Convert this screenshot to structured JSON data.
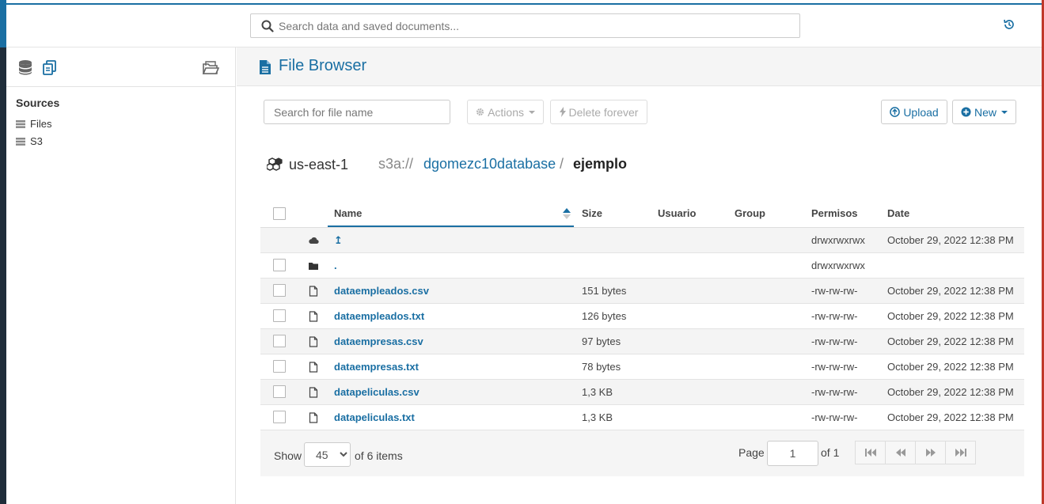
{
  "search": {
    "placeholder": "Search data and saved documents..."
  },
  "sidebar": {
    "sources_title": "Sources",
    "items": [
      {
        "label": "Files"
      },
      {
        "label": "S3"
      }
    ]
  },
  "main": {
    "title": "File Browser",
    "file_search_placeholder": "Search for file name",
    "actions_label": "Actions",
    "delete_label": "Delete forever",
    "upload_label": "Upload",
    "new_label": "New"
  },
  "breadcrumb": {
    "region": "us-east-1",
    "scheme": "s3a://",
    "bucket": "dgomezc10database",
    "separator": "/",
    "folder": "ejemplo"
  },
  "table": {
    "headers": {
      "name": "Name",
      "size": "Size",
      "user": "Usuario",
      "group": "Group",
      "perms": "Permisos",
      "date": "Date"
    },
    "rows": [
      {
        "icon": "cloud-icon",
        "name": "↥",
        "size": "",
        "user": "",
        "group": "",
        "perms": "drwxrwxrwx",
        "date": "October 29, 2022 12:38 PM",
        "checkbox": false
      },
      {
        "icon": "folder-icon",
        "name": ".",
        "size": "",
        "user": "",
        "group": "",
        "perms": "drwxrwxrwx",
        "date": "",
        "checkbox": true
      },
      {
        "icon": "file-icon",
        "name": "dataempleados.csv",
        "size": "151 bytes",
        "user": "",
        "group": "",
        "perms": "-rw-rw-rw-",
        "date": "October 29, 2022 12:38 PM",
        "checkbox": true
      },
      {
        "icon": "file-icon",
        "name": "dataempleados.txt",
        "size": "126 bytes",
        "user": "",
        "group": "",
        "perms": "-rw-rw-rw-",
        "date": "October 29, 2022 12:38 PM",
        "checkbox": true
      },
      {
        "icon": "file-icon",
        "name": "dataempresas.csv",
        "size": "97 bytes",
        "user": "",
        "group": "",
        "perms": "-rw-rw-rw-",
        "date": "October 29, 2022 12:38 PM",
        "checkbox": true
      },
      {
        "icon": "file-icon",
        "name": "dataempresas.txt",
        "size": "78 bytes",
        "user": "",
        "group": "",
        "perms": "-rw-rw-rw-",
        "date": "October 29, 2022 12:38 PM",
        "checkbox": true
      },
      {
        "icon": "file-icon",
        "name": "datapeliculas.csv",
        "size": "1,3 KB",
        "user": "",
        "group": "",
        "perms": "-rw-rw-rw-",
        "date": "October 29, 2022 12:38 PM",
        "checkbox": true
      },
      {
        "icon": "file-icon",
        "name": "datapeliculas.txt",
        "size": "1,3 KB",
        "user": "",
        "group": "",
        "perms": "-rw-rw-rw-",
        "date": "October 29, 2022 12:38 PM",
        "checkbox": true
      }
    ]
  },
  "footer": {
    "show_label": "Show",
    "page_size": "45",
    "items_label": "of 6 items",
    "page_label": "Page",
    "page_value": "1",
    "of_label": "of 1"
  },
  "colors": {
    "accent": "#1a6fa3",
    "frame_dark": "#1f2d3a",
    "frame_right": "#c0392b",
    "row_shade": "#f4f4f4"
  }
}
